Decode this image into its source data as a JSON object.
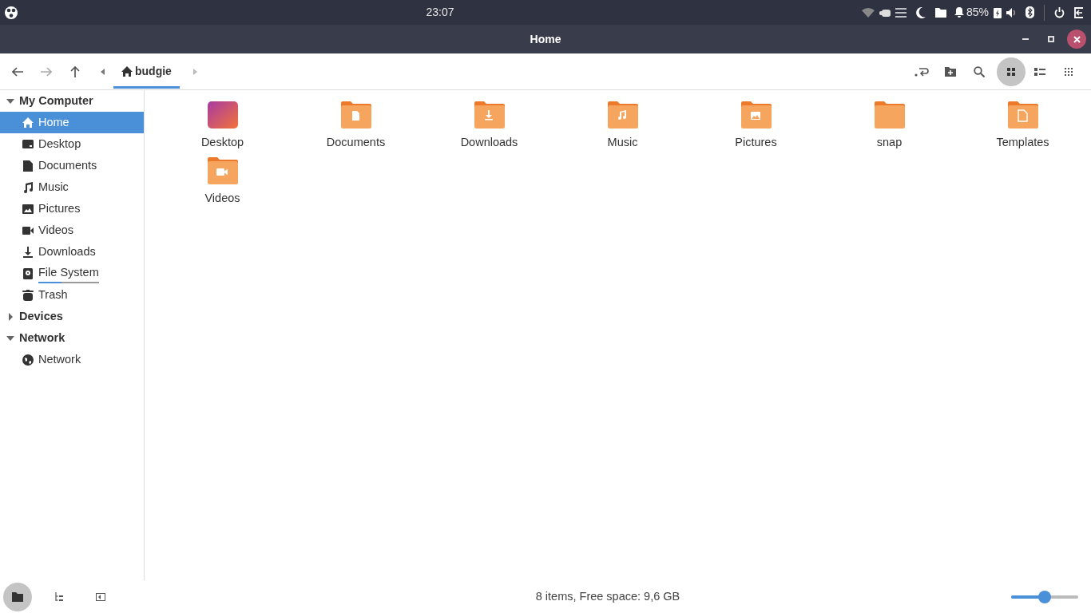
{
  "top_panel": {
    "clock": "23:07",
    "battery": "85%"
  },
  "window": {
    "title": "Home"
  },
  "toolbar": {
    "breadcrumb": "budgie",
    "view_modes": [
      {
        "kind": "icons",
        "selected": true
      },
      {
        "kind": "list",
        "selected": false
      },
      {
        "kind": "compact",
        "selected": false
      }
    ]
  },
  "sidebar": {
    "sections": [
      {
        "label": "My Computer",
        "expanded": true,
        "items": [
          {
            "label": "Home",
            "kind": "home",
            "selected": true
          },
          {
            "label": "Desktop",
            "kind": "desktop",
            "selected": false
          },
          {
            "label": "Documents",
            "kind": "document",
            "selected": false
          },
          {
            "label": "Music",
            "kind": "music",
            "selected": false
          },
          {
            "label": "Pictures",
            "kind": "picture",
            "selected": false
          },
          {
            "label": "Videos",
            "kind": "video",
            "selected": false
          },
          {
            "label": "Downloads",
            "kind": "download",
            "selected": false
          },
          {
            "label": "File System",
            "kind": "drive",
            "selected": false,
            "level": 0.38
          },
          {
            "label": "Trash",
            "kind": "trash",
            "selected": false
          }
        ]
      },
      {
        "label": "Devices",
        "expanded": false
      },
      {
        "label": "Network",
        "expanded": true,
        "items": [
          {
            "label": "Network",
            "kind": "globe",
            "selected": false
          }
        ]
      }
    ]
  },
  "files": [
    {
      "name": "Desktop",
      "kind": "desktop"
    },
    {
      "name": "Documents",
      "kind": "document"
    },
    {
      "name": "Downloads",
      "kind": "download"
    },
    {
      "name": "Music",
      "kind": "music"
    },
    {
      "name": "Pictures",
      "kind": "picture"
    },
    {
      "name": "snap",
      "kind": "plain"
    },
    {
      "name": "Templates",
      "kind": "template"
    },
    {
      "name": "Videos",
      "kind": "video"
    }
  ],
  "status_bar": {
    "text": "8 items, Free space: 9,6 GB",
    "zoom": {
      "level": 0.5
    },
    "pane_buttons": [
      {
        "kind": "places",
        "selected": true
      },
      {
        "kind": "tree",
        "selected": false
      },
      {
        "kind": "hide",
        "selected": false
      }
    ]
  }
}
